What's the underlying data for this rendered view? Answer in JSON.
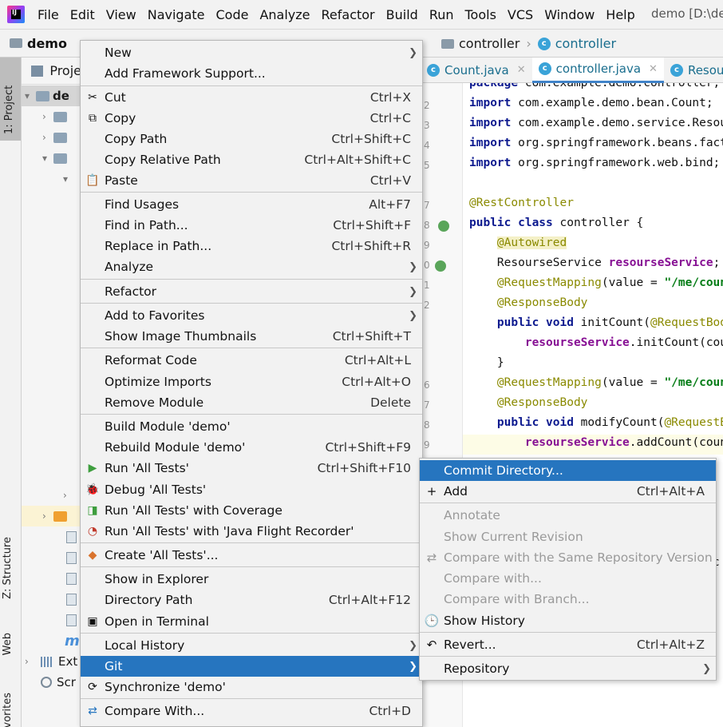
{
  "menubar": {
    "items": [
      "File",
      "Edit",
      "View",
      "Navigate",
      "Code",
      "Analyze",
      "Refactor",
      "Build",
      "Run",
      "Tools",
      "VCS",
      "Window",
      "Help"
    ],
    "window_title": "demo [D:\\de"
  },
  "navbar": {
    "project": "demo",
    "folder": "controller",
    "class": "controller"
  },
  "toolstrip": {
    "project_tab": "1: Project",
    "structure_tab": "Z: Structure",
    "web_tab": "Web",
    "favorites_tab": "vorites"
  },
  "project_panel": {
    "title": "Proje",
    "root": "de",
    "ext_row": "Ext",
    "scr_row": "Scr"
  },
  "editor": {
    "tabs": [
      {
        "label": "Count.java"
      },
      {
        "label": "controller.java"
      },
      {
        "label": "Resourse"
      }
    ],
    "line_numbers": [
      "1",
      "2",
      "3",
      "4",
      "5",
      "6",
      "7",
      "8",
      "9",
      "0",
      "1",
      "2",
      "3",
      "4",
      "5",
      "6",
      "7",
      "8",
      "9"
    ]
  },
  "context_menu": {
    "items": {
      "new": {
        "label": "New"
      },
      "add_framework": {
        "label": "Add Framework Support..."
      },
      "cut": {
        "label": "Cut",
        "shortcut": "Ctrl+X"
      },
      "copy": {
        "label": "Copy",
        "shortcut": "Ctrl+C"
      },
      "copy_path": {
        "label": "Copy Path",
        "shortcut": "Ctrl+Shift+C"
      },
      "copy_relative_path": {
        "label": "Copy Relative Path",
        "shortcut": "Ctrl+Alt+Shift+C"
      },
      "paste": {
        "label": "Paste",
        "shortcut": "Ctrl+V"
      },
      "find_usages": {
        "label": "Find Usages",
        "shortcut": "Alt+F7"
      },
      "find_in_path": {
        "label": "Find in Path...",
        "shortcut": "Ctrl+Shift+F"
      },
      "replace_in_path": {
        "label": "Replace in Path...",
        "shortcut": "Ctrl+Shift+R"
      },
      "analyze": {
        "label": "Analyze"
      },
      "refactor": {
        "label": "Refactor"
      },
      "add_to_favorites": {
        "label": "Add to Favorites"
      },
      "show_image_thumbnails": {
        "label": "Show Image Thumbnails",
        "shortcut": "Ctrl+Shift+T"
      },
      "reformat_code": {
        "label": "Reformat Code",
        "shortcut": "Ctrl+Alt+L"
      },
      "optimize_imports": {
        "label": "Optimize Imports",
        "shortcut": "Ctrl+Alt+O"
      },
      "remove_module": {
        "label": "Remove Module",
        "shortcut": "Delete"
      },
      "build_module": {
        "label": "Build Module 'demo'"
      },
      "rebuild_module": {
        "label": "Rebuild Module 'demo'",
        "shortcut": "Ctrl+Shift+F9"
      },
      "run_all_tests": {
        "label": "Run 'All Tests'",
        "shortcut": "Ctrl+Shift+F10"
      },
      "debug_all_tests": {
        "label": "Debug 'All Tests'"
      },
      "run_with_coverage": {
        "label": "Run 'All Tests' with Coverage"
      },
      "run_with_jfr": {
        "label": "Run 'All Tests' with 'Java Flight Recorder'"
      },
      "create_all_tests": {
        "label": "Create 'All Tests'..."
      },
      "show_in_explorer": {
        "label": "Show in Explorer"
      },
      "directory_path": {
        "label": "Directory Path",
        "shortcut": "Ctrl+Alt+F12"
      },
      "open_in_terminal": {
        "label": "Open in Terminal"
      },
      "local_history": {
        "label": "Local History"
      },
      "git": {
        "label": "Git"
      },
      "synchronize": {
        "label": "Synchronize 'demo'"
      },
      "compare_with": {
        "label": "Compare With...",
        "shortcut": "Ctrl+D"
      }
    }
  },
  "git_submenu": {
    "items": {
      "commit_directory": {
        "label": "Commit Directory..."
      },
      "add": {
        "label": "Add",
        "shortcut": "Ctrl+Alt+A"
      },
      "annotate": {
        "label": "Annotate"
      },
      "show_current_revision": {
        "label": "Show Current Revision"
      },
      "compare_same_repo": {
        "label": "Compare with the Same Repository Version"
      },
      "compare_with": {
        "label": "Compare with..."
      },
      "compare_with_branch": {
        "label": "Compare with Branch..."
      },
      "show_history": {
        "label": "Show History"
      },
      "revert": {
        "label": "Revert...",
        "shortcut": "Ctrl+Alt+Z"
      },
      "repository": {
        "label": "Repository"
      }
    }
  },
  "colors": {
    "selection": "#2675bf",
    "menu_bg": "#f2f2f2",
    "keyword": "#0d1a8f",
    "annotation": "#8a8a00",
    "string": "#067d17",
    "field": "#871094"
  }
}
